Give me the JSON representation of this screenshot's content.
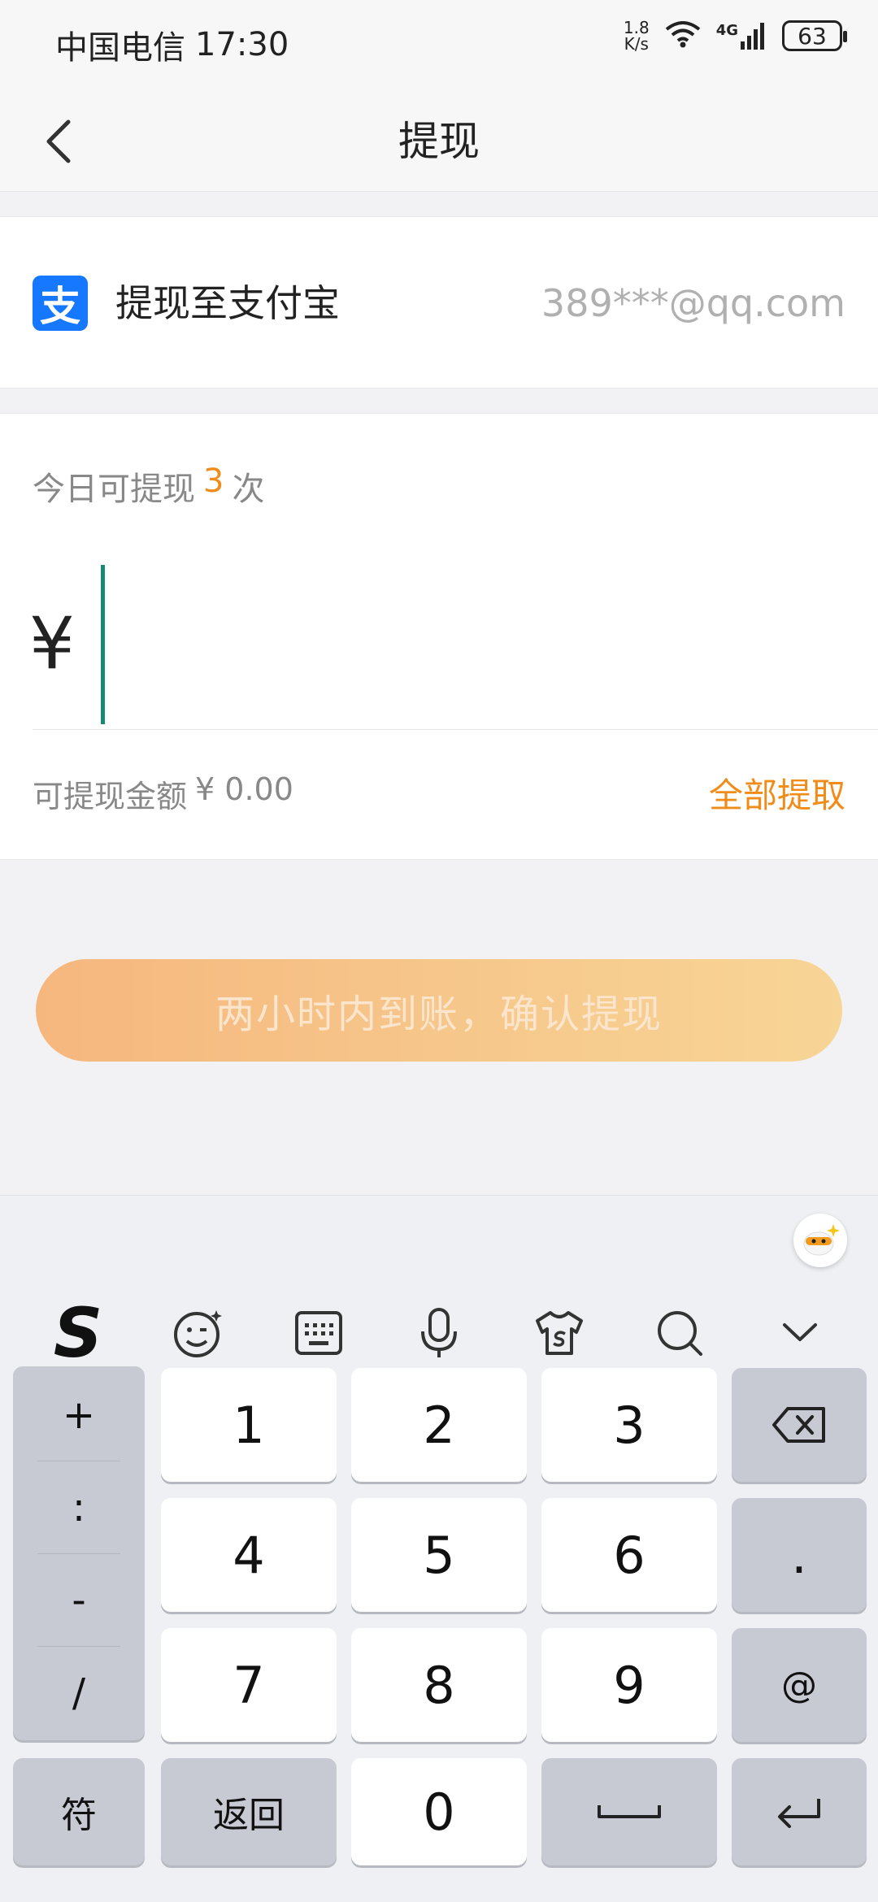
{
  "status_bar": {
    "carrier": "中国电信",
    "time": "17:30",
    "net_speed_value": "1.8",
    "net_speed_unit": "K/s",
    "network_type": "4G",
    "battery": "63"
  },
  "header": {
    "title": "提现",
    "back_icon": "chevron-left-icon"
  },
  "account": {
    "icon": "alipay-icon",
    "icon_glyph": "支",
    "label": "提现至支付宝",
    "value": "389***@qq.com"
  },
  "withdraw": {
    "times_prefix": "今日可提现",
    "times_count": "3",
    "times_suffix": "次",
    "currency_symbol": "¥",
    "amount_value": "",
    "available_label": "可提现金额",
    "available_amount": "¥ 0.00",
    "withdraw_all_label": "全部提取"
  },
  "confirm": {
    "label": "两小时内到账，确认提现"
  },
  "keyboard": {
    "toolbar_icons": [
      "sogou-logo-icon",
      "emoji-icon",
      "keyboard-icon",
      "microphone-icon",
      "skin-shirt-icon",
      "search-icon",
      "collapse-chevron-icon"
    ],
    "sogou_glyph": "S",
    "side_keys": [
      "+",
      ":",
      "-",
      "/"
    ],
    "digit_rows": [
      [
        "1",
        "2",
        "3"
      ],
      [
        "4",
        "5",
        "6"
      ],
      [
        "7",
        "8",
        "9"
      ]
    ],
    "right_keys": [
      "backspace-icon",
      ".",
      "@",
      "enter-icon"
    ],
    "symbol_key": "符",
    "back_key": "返回",
    "zero_key": "0",
    "space_icon": "space-icon"
  },
  "colors": {
    "accent_orange": "#f08c1a",
    "cursor_green": "#148a70",
    "alipay_blue": "#1677ff",
    "button_gradient_start": "#f6b77e",
    "button_gradient_end": "#f7d596"
  }
}
